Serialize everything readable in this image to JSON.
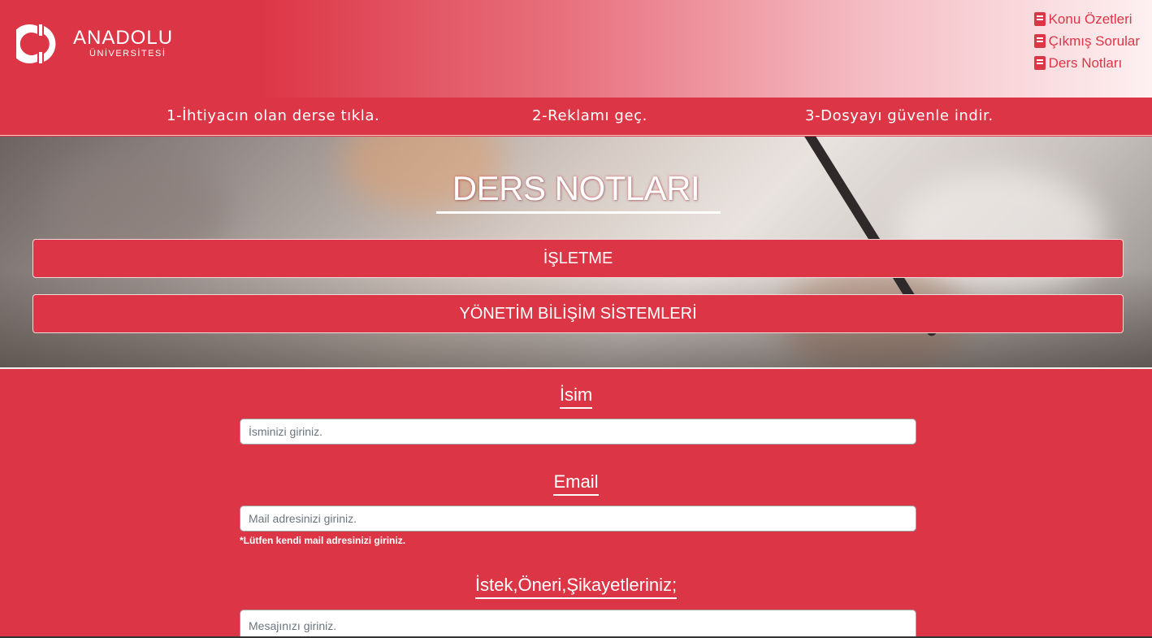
{
  "header": {
    "logo": {
      "name": "ANADOLU",
      "subtitle": "ÜNİVERSİTESİ"
    },
    "nav": [
      {
        "label": "Konu Özetleri",
        "icon": "book-icon"
      },
      {
        "label": "Çıkmış Sorular",
        "icon": "book-icon"
      },
      {
        "label": "Ders Notları",
        "icon": "book-icon"
      }
    ]
  },
  "steps": [
    "1-İhtiyacın olan derse tıkla.",
    "2-Reklamı geç.",
    "3-Dosyayı güvenle indir."
  ],
  "hero": {
    "title": "DERS NOTLARI",
    "courses": [
      "İŞLETME",
      "YÖNETİM BİLİŞİM SİSTEMLERİ"
    ]
  },
  "form": {
    "name": {
      "label": "İsim",
      "placeholder": "İsminizi giriniz."
    },
    "email": {
      "label": "Email",
      "placeholder": "Mail adresinizi giriniz.",
      "note": "*Lütfen kendi mail adresinizi giriniz."
    },
    "message": {
      "label": "İstek,Öneri,Şikayetleriniz;",
      "placeholder": "Mesajınızı giriniz."
    }
  },
  "colors": {
    "accent": "#dc3545",
    "text_on_accent": "#ffffff"
  }
}
